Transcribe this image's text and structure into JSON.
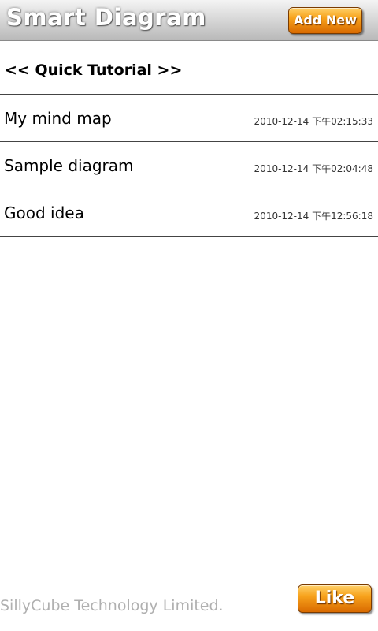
{
  "header": {
    "title": "Smart Diagram",
    "add_new_label": "Add New"
  },
  "tutorial": {
    "label": "<< Quick Tutorial >>"
  },
  "diagrams": [
    {
      "name": "My mind map",
      "date": "2010-12-14 下午02:15:33"
    },
    {
      "name": "Sample diagram",
      "date": "2010-12-14 下午02:04:48"
    },
    {
      "name": "Good idea",
      "date": "2010-12-14 下午12:56:18"
    }
  ],
  "footer": {
    "company": "SillyCube Technology Limited.",
    "like_label": "Like"
  },
  "colors": {
    "accent": "#f7a21c",
    "title_bar": "#d9d9d9",
    "divider": "#444444",
    "footer_text": "#b0b0b0"
  }
}
